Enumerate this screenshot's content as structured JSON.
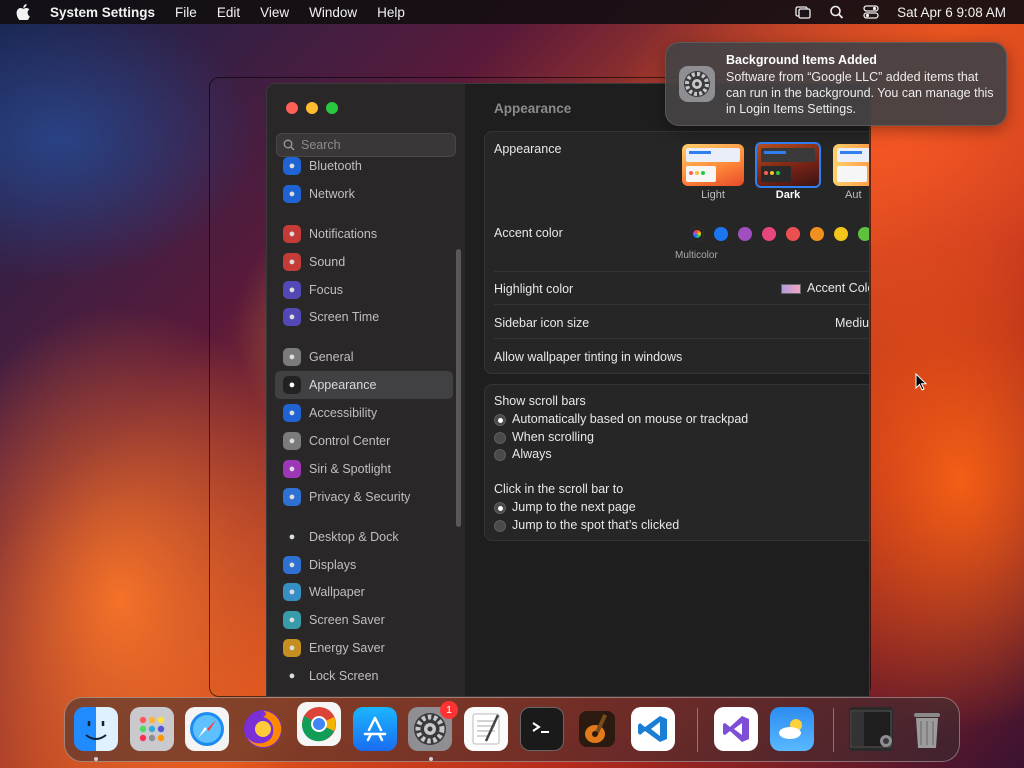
{
  "menubar": {
    "app_name": "System Settings",
    "menus": [
      "File",
      "Edit",
      "View",
      "Window",
      "Help"
    ],
    "datetime": "Sat Apr 6  9:08 AM"
  },
  "notification": {
    "title": "Background Items Added",
    "body": "Software from “Google LLC” added items that can run in the background. You can manage this in Login Items Settings."
  },
  "sidebar": {
    "search_placeholder": "Search",
    "items": [
      {
        "label": "Bluetooth",
        "icon": "bluetooth-icon",
        "color": "#1e6ff0"
      },
      {
        "label": "Network",
        "icon": "globe-icon",
        "color": "#1e6ff0"
      },
      {
        "label": "Notifications",
        "icon": "bell-icon",
        "color": "#e0403a"
      },
      {
        "label": "Sound",
        "icon": "speaker-icon",
        "color": "#e0403a"
      },
      {
        "label": "Focus",
        "icon": "moon-icon",
        "color": "#5a4fcf"
      },
      {
        "label": "Screen Time",
        "icon": "hourglass-icon",
        "color": "#5a4fcf"
      },
      {
        "label": "General",
        "icon": "gear-icon",
        "color": "#8a8a8a"
      },
      {
        "label": "Appearance",
        "icon": "appearance-icon",
        "color": "#222222"
      },
      {
        "label": "Accessibility",
        "icon": "accessibility-icon",
        "color": "#1e6ff0"
      },
      {
        "label": "Control Center",
        "icon": "control-center-icon",
        "color": "#8a8a8a"
      },
      {
        "label": "Siri & Spotlight",
        "icon": "siri-icon",
        "color": "#b03ad0"
      },
      {
        "label": "Privacy & Security",
        "icon": "hand-icon",
        "color": "#2f7ff0"
      },
      {
        "label": "Desktop & Dock",
        "icon": "dock-icon",
        "color": "#2a2a2a"
      },
      {
        "label": "Displays",
        "icon": "sun-icon",
        "color": "#2f7ff0"
      },
      {
        "label": "Wallpaper",
        "icon": "wallpaper-icon",
        "color": "#3aa0e0"
      },
      {
        "label": "Screen Saver",
        "icon": "screensaver-icon",
        "color": "#3ab0c0"
      },
      {
        "label": "Energy Saver",
        "icon": "battery-icon",
        "color": "#e0a020"
      },
      {
        "label": "Lock Screen",
        "icon": "lock-icon",
        "color": "#2a2a2a"
      }
    ],
    "selected": "Appearance"
  },
  "main": {
    "title": "Appearance",
    "appearance": {
      "label": "Appearance",
      "options": [
        "Light",
        "Dark",
        "Aut"
      ],
      "selected": "Dark"
    },
    "accent": {
      "label": "Accent color",
      "colors": [
        "multicolor",
        "#1b76f2",
        "#a04fc0",
        "#e8467f",
        "#ec4f4f",
        "#f0901f",
        "#f3c419",
        "#5fc23f"
      ],
      "caption": "Multicolor"
    },
    "highlight": {
      "label": "Highlight color",
      "value": "Accent Colo"
    },
    "sidebar_icon": {
      "label": "Sidebar icon size",
      "value": "Mediu"
    },
    "tinting": {
      "label": "Allow wallpaper tinting in windows"
    },
    "scrollbars": {
      "label": "Show scroll bars",
      "options": [
        "Automatically based on mouse or trackpad",
        "When scrolling",
        "Always"
      ],
      "selected": 0
    },
    "click": {
      "label": "Click in the scroll bar to",
      "options": [
        "Jump to the next page",
        "Jump to the spot that’s clicked"
      ],
      "selected": 0
    }
  },
  "dock": {
    "settings_badge": "1"
  }
}
